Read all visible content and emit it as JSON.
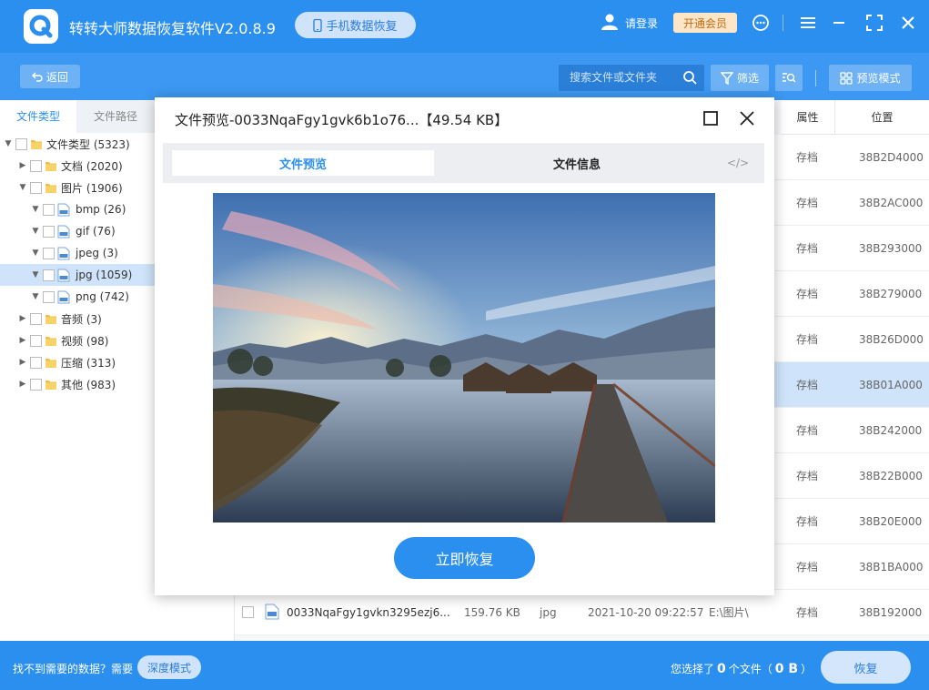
{
  "app": {
    "title": "转转大师数据恢复软件V2.0.8.9",
    "mobile_recovery": "手机数据恢复",
    "login": "请登录",
    "vip": "开通会员"
  },
  "toolbar": {
    "back": "返回",
    "search_placeholder": "搜索文件或文件夹",
    "filter": "筛选",
    "preview_mode": "预览模式"
  },
  "left_tabs": {
    "by_type": "文件类型",
    "by_path": "文件路径"
  },
  "tree": [
    {
      "label": "文件类型 (5323)",
      "level": 0,
      "expanded": true,
      "icon": "folder-icon"
    },
    {
      "label": "文档 (2020)",
      "level": 1,
      "expanded": false,
      "icon": "folder-icon"
    },
    {
      "label": "图片 (1906)",
      "level": 1,
      "expanded": true,
      "icon": "folder-icon"
    },
    {
      "label": "bmp (26)",
      "level": 2,
      "expanded": true,
      "icon": "image-file-icon"
    },
    {
      "label": "gif (76)",
      "level": 2,
      "expanded": true,
      "icon": "image-file-icon"
    },
    {
      "label": "jpeg (3)",
      "level": 2,
      "expanded": true,
      "icon": "image-file-icon"
    },
    {
      "label": "jpg (1059)",
      "level": 2,
      "expanded": true,
      "icon": "image-file-icon",
      "selected": true
    },
    {
      "label": "png (742)",
      "level": 2,
      "expanded": true,
      "icon": "image-file-icon"
    },
    {
      "label": "音频 (3)",
      "level": 1,
      "expanded": false,
      "icon": "folder-icon"
    },
    {
      "label": "视频 (98)",
      "level": 1,
      "expanded": false,
      "icon": "folder-icon"
    },
    {
      "label": "压缩 (313)",
      "level": 1,
      "expanded": false,
      "icon": "folder-icon"
    },
    {
      "label": "其他 (983)",
      "level": 1,
      "expanded": false,
      "icon": "folder-icon"
    }
  ],
  "table": {
    "headers": {
      "attribute": "属性",
      "location": "位置"
    },
    "rows": [
      {
        "attribute": "存档",
        "location": "38B2D4000"
      },
      {
        "attribute": "存档",
        "location": "38B2AC000"
      },
      {
        "attribute": "存档",
        "location": "38B293000"
      },
      {
        "attribute": "存档",
        "location": "38B279000"
      },
      {
        "attribute": "存档",
        "location": "38B26D000"
      },
      {
        "attribute": "存档",
        "location": "38B01A000",
        "selected": true
      },
      {
        "attribute": "存档",
        "location": "38B242000"
      },
      {
        "attribute": "存档",
        "location": "38B22B000"
      },
      {
        "attribute": "存档",
        "location": "38B20E000"
      },
      {
        "attribute": "存档",
        "location": "38B1BA000"
      },
      {
        "name": "0033NqaFgy1gvkn3295ezj6...",
        "size": "159.76 KB",
        "type": "jpg",
        "date": "2021-10-20 09:22:57",
        "path": "E:\\图片\\",
        "attribute": "存档",
        "location": "38B192000"
      }
    ]
  },
  "modal": {
    "title": "文件预览-0033NqaFgy1gvk6b1o76...【49.54 KB】",
    "tab_preview": "文件预览",
    "tab_info": "文件信息",
    "tab_code": "</>",
    "recover_now": "立即恢复"
  },
  "footer": {
    "hint": "找不到需要的数据？需要",
    "deep_mode": "深度模式",
    "selected_prefix": "您选择了",
    "selected_count": "0",
    "selected_mid": "个文件（",
    "selected_size": "0 B",
    "selected_suffix": "）",
    "restore": "恢复"
  },
  "colors": {
    "brand": "#2b8ff0",
    "selected_row": "#cfe4fb"
  }
}
